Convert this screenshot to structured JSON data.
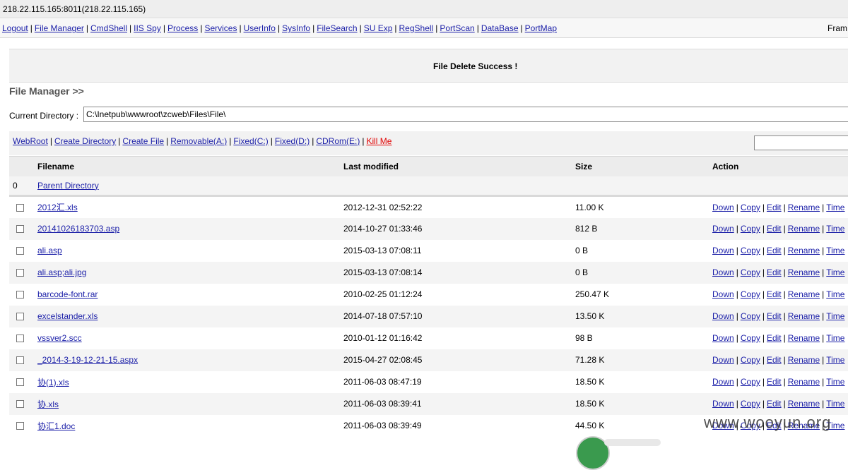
{
  "window": {
    "title": "218.22.115.165:8011(218.22.115.165)"
  },
  "menu": {
    "items": [
      "Logout",
      "File Manager",
      "CmdShell",
      "IIS Spy",
      "Process",
      "Services",
      "UserInfo",
      "SysInfo",
      "FileSearch",
      "SU Exp",
      "RegShell",
      "PortScan",
      "DataBase",
      "PortMap"
    ],
    "frame_label": "Fram"
  },
  "notice": {
    "message": "File Delete Success !"
  },
  "file_manager": {
    "title": "File Manager >>",
    "current_dir_label": "Current Directory :",
    "current_dir_value": "C:\\Inetpub\\wwwroot\\zcweb\\Files\\File\\",
    "drive_links": [
      "WebRoot",
      "Create Directory",
      "Create File",
      "Removable(A:)",
      "Fixed(C:)",
      "Fixed(D:)",
      "CDRom(E:)"
    ],
    "kill_label": "Kill Me",
    "kill_color": "#e10000",
    "columns": {
      "filename": "Filename",
      "modified": "Last modified",
      "size": "Size",
      "action": "Action"
    },
    "parent": {
      "index": "0",
      "label": "Parent Directory"
    },
    "action_labels": [
      "Down",
      "Copy",
      "Edit",
      "Rename",
      "Time"
    ],
    "files": [
      {
        "name": "2012汇.xls",
        "modified": "2012-12-31 02:52:22",
        "size": "11.00 K"
      },
      {
        "name": "20141026183703.asp",
        "modified": "2014-10-27 01:33:46",
        "size": "812 B"
      },
      {
        "name": "ali.asp",
        "modified": "2015-03-13 07:08:11",
        "size": "0 B"
      },
      {
        "name": "ali.asp;ali.jpg",
        "modified": "2015-03-13 07:08:14",
        "size": "0 B"
      },
      {
        "name": "barcode-font.rar",
        "modified": "2010-02-25 01:12:24",
        "size": "250.47 K"
      },
      {
        "name": "excelstander.xls",
        "modified": "2014-07-18 07:57:10",
        "size": "13.50 K"
      },
      {
        "name": "vssver2.scc",
        "modified": "2010-01-12 01:16:42",
        "size": "98 B"
      },
      {
        "name": "_2014-3-19-12-21-15.aspx",
        "modified": "2015-04-27 02:08:45",
        "size": "71.28 K"
      },
      {
        "name": "协(1).xls",
        "modified": "2011-06-03 08:47:19",
        "size": "18.50 K"
      },
      {
        "name": "协.xls",
        "modified": "2011-06-03 08:39:41",
        "size": "18.50 K"
      },
      {
        "name": "协汇1.doc",
        "modified": "2011-06-03 08:39:49",
        "size": "44.50 K"
      }
    ]
  },
  "watermark": {
    "text": "www.wooyun.org"
  },
  "colors": {
    "link": "#1b1fa8",
    "titlebar_bg": "#eeeeee",
    "row_alt_bg": "#f4f4f4"
  }
}
